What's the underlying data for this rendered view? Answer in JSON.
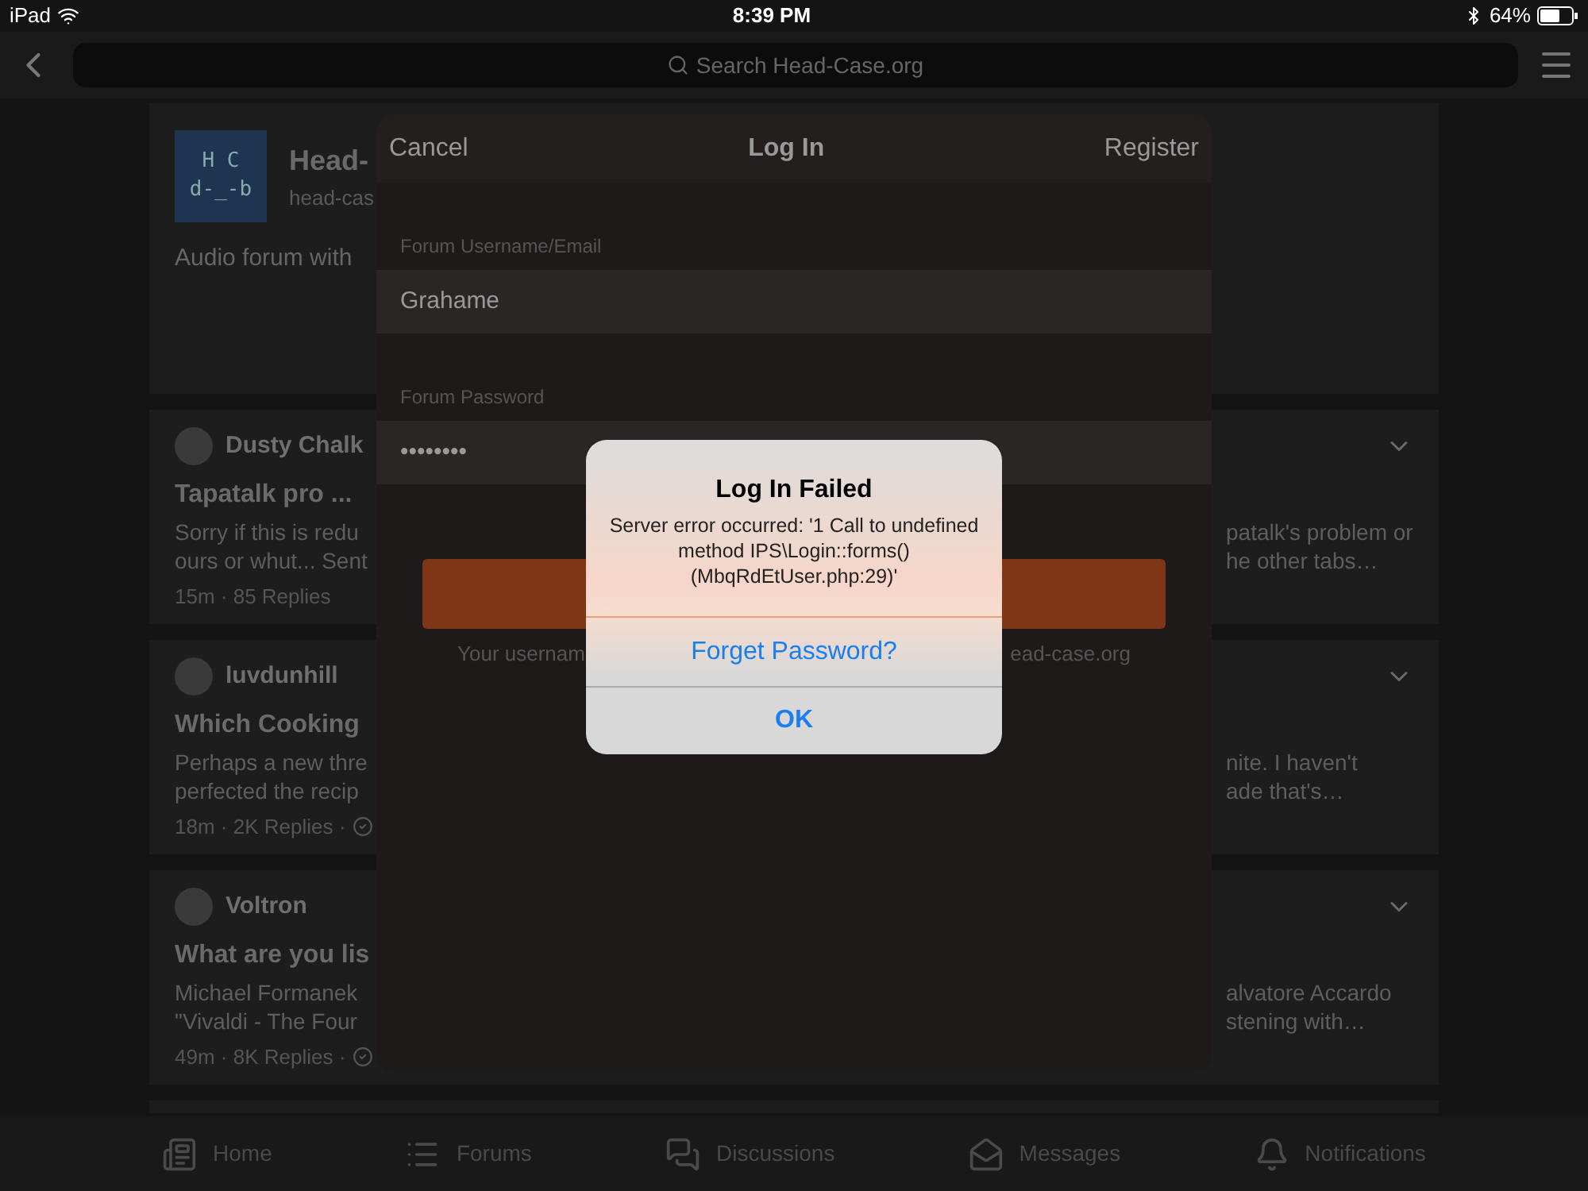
{
  "status_bar": {
    "device": "iPad",
    "time": "8:39 PM",
    "battery": "64%"
  },
  "nav": {
    "search_placeholder": "Search Head-Case.org"
  },
  "forum_card": {
    "logo_lines": [
      "H C",
      "d-_-b"
    ],
    "name": "Head-",
    "url": "head-cas",
    "description": "Audio forum with"
  },
  "topics": [
    {
      "author": "Dusty Chalk",
      "title": "Tapatalk pro ...",
      "excerpt_left": [
        "Sorry if this is redu",
        "ours or whut... Sent"
      ],
      "excerpt_right": [
        "patalk's problem or",
        "he other tabs…"
      ],
      "meta": "15m · 85 Replies",
      "answered": false
    },
    {
      "author": "luvdunhill",
      "title": "Which Cooking",
      "excerpt_left": [
        "Perhaps a new thre",
        "perfected the recip"
      ],
      "excerpt_right": [
        "nite. I haven't",
        "ade that's…"
      ],
      "meta": "18m · 2K Replies ·",
      "answered": true
    },
    {
      "author": "Voltron",
      "title": "What are you lis",
      "excerpt_left": [
        "Michael Formanek",
        "\"Vivaldi - The Four"
      ],
      "excerpt_right": [
        "alvatore Accardo",
        "stening with…"
      ],
      "meta": "49m · 8K Replies ·",
      "answered": true
    }
  ],
  "tabs": [
    {
      "label": "Home",
      "kind": "home"
    },
    {
      "label": "Forums",
      "kind": "forums"
    },
    {
      "label": "Discussions",
      "kind": "discussions"
    },
    {
      "label": "Messages",
      "kind": "messages"
    },
    {
      "label": "Notifications",
      "kind": "notifications"
    }
  ],
  "login_sheet": {
    "cancel": "Cancel",
    "title": "Log In",
    "register": "Register",
    "fields": [
      {
        "label": "Forum Username/Email",
        "value": "Grahame"
      },
      {
        "label": "Forum Password",
        "value": "••••••••"
      }
    ],
    "helper_left": "Your usernam",
    "helper_right": "ead-case.org"
  },
  "alert": {
    "title": "Log In Failed",
    "message": "Server error occurred: '1 Call to undefined method IPS\\Login::forms() (MbqRdEtUser.php:29)'",
    "buttons": [
      "Forget Password?",
      "OK"
    ]
  }
}
